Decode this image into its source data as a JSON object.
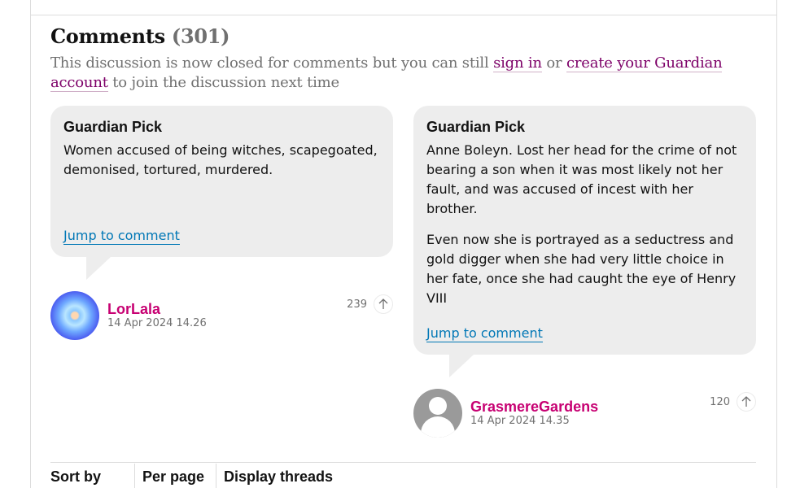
{
  "comments": {
    "title": "Comments",
    "count": "(301)",
    "notice_prefix": "This discussion is now closed for comments but you can still ",
    "sign_in": "sign in",
    "notice_or": " or ",
    "create_account": "create your Guardian account",
    "notice_suffix": " to join the discussion next time"
  },
  "picks": [
    {
      "label": "Guardian Pick",
      "paragraphs": [
        "Women accused of being witches, scapegoated, demonised, tortured, murdered."
      ],
      "jump": "Jump to comment",
      "author": "LorLala",
      "date": "14 Apr 2024 14.26",
      "votes": "239"
    },
    {
      "label": "Guardian Pick",
      "paragraphs": [
        "Anne Boleyn. Lost her head for the crime of not bearing a son when it was most likely not her fault, and was accused of incest with her brother.",
        "Even now she is portrayed as a seductress and gold digger when she had very little choice in her fate, once she had caught the eye of Henry VIII"
      ],
      "jump": "Jump to comment",
      "author": "GrasmereGardens",
      "date": "14 Apr 2024 14.35",
      "votes": "120"
    }
  ],
  "controls": {
    "sort_by": "Sort by",
    "per_page": "Per page",
    "display_threads": "Display threads"
  },
  "colors": {
    "author": "#c70072",
    "link": "#0077b6",
    "signin": "#7d0068",
    "bubble": "#ededed"
  },
  "icons": {
    "upvote": "arrow-up-icon"
  }
}
